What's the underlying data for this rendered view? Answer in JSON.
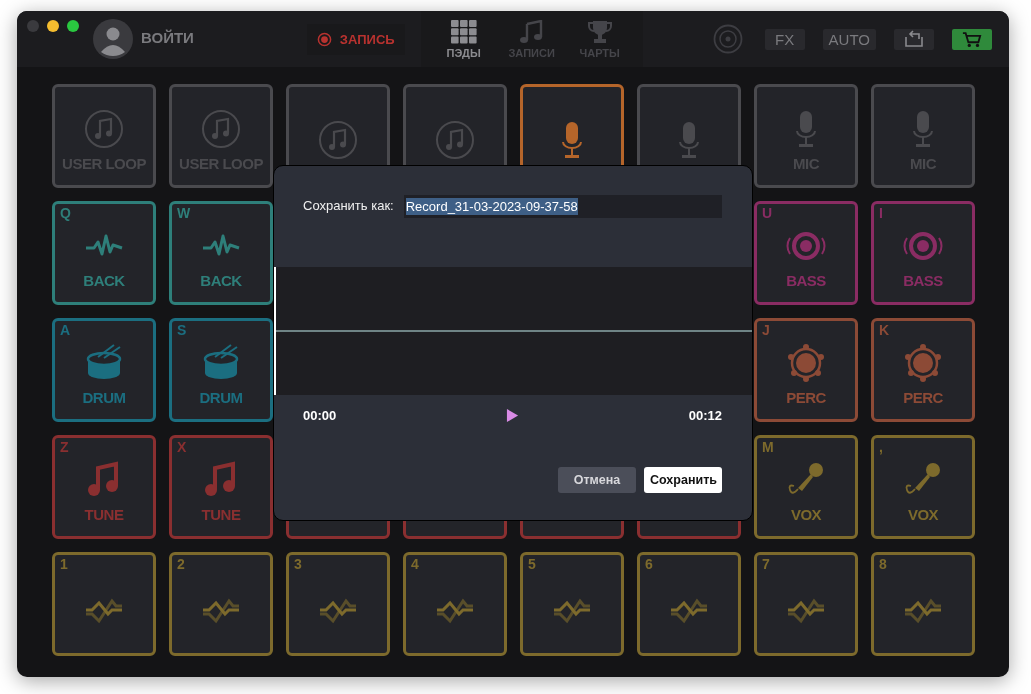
{
  "topbar": {
    "login": "ВОЙТИ",
    "record": "ЗАПИСЬ",
    "tabs": [
      {
        "label": "ПЭДЫ",
        "kind": "grid",
        "selected": true
      },
      {
        "label": "ЗАПИСИ",
        "kind": "notes",
        "selected": false
      },
      {
        "label": "ЧАРТЫ",
        "kind": "trophy",
        "selected": false
      }
    ],
    "buttons": [
      {
        "kind": "text",
        "label": "FX"
      },
      {
        "kind": "text",
        "label": "AUTO"
      },
      {
        "kind": "undo"
      },
      {
        "kind": "cart"
      }
    ]
  },
  "pads": [
    [
      {
        "kind": "loop",
        "label": "USER LOOP",
        "color": "#4a4a4e"
      },
      {
        "kind": "loop",
        "label": "USER LOOP",
        "color": "#4a4a4e"
      },
      {
        "kind": "loop",
        "color": "#4a4a4e"
      },
      {
        "kind": "loop",
        "color": "#4a4a4e"
      },
      {
        "kind": "mic",
        "color": "#b5652a"
      },
      {
        "kind": "mic",
        "color": "#4a4a4e"
      },
      {
        "kind": "mic",
        "label": "MIC",
        "color": "#4a4a4e"
      },
      {
        "kind": "mic",
        "label": "MIC",
        "color": "#4a4a4e"
      }
    ],
    [
      {
        "key": "Q",
        "kind": "back",
        "label": "BACK",
        "color": "#2e7f7a"
      },
      {
        "key": "W",
        "kind": "back",
        "label": "BACK",
        "color": "#2e7f7a"
      },
      {
        "key": "U",
        "kind": "bass",
        "label": "BASS",
        "color": "#8a2c63"
      },
      {
        "key": "I",
        "kind": "bass",
        "label": "BASS",
        "color": "#8a2c63"
      }
    ],
    [
      {
        "key": "A",
        "kind": "drum",
        "label": "DRUM",
        "color": "#1b6e80"
      },
      {
        "key": "S",
        "kind": "drum",
        "label": "DRUM",
        "color": "#1b6e80"
      },
      {
        "key": "J",
        "kind": "perc",
        "label": "PERC",
        "color": "#8c4a36"
      },
      {
        "key": "K",
        "kind": "perc",
        "label": "PERC",
        "color": "#8c4a36"
      }
    ],
    [
      {
        "key": "Z",
        "kind": "tune",
        "label": "TUNE",
        "color": "#8a2f30"
      },
      {
        "key": "X",
        "kind": "tune",
        "label": "TUNE",
        "color": "#8a2f30"
      },
      {
        "color": "#8a2f30"
      },
      {
        "color": "#8a2f30"
      },
      {
        "color": "#8a2f30"
      },
      {
        "color": "#8a2f30"
      },
      {
        "key": "M",
        "kind": "vox",
        "label": "VOX",
        "color": "#7d6a2c"
      },
      {
        "key": ",",
        "kind": "vox",
        "label": "VOX",
        "color": "#7d6a2c"
      }
    ],
    [
      {
        "key": "1",
        "kind": "fx",
        "color": "#7d6a2c"
      },
      {
        "key": "2",
        "kind": "fx",
        "color": "#7d6a2c"
      },
      {
        "key": "3",
        "kind": "fx",
        "color": "#7d6a2c"
      },
      {
        "key": "4",
        "kind": "fx",
        "color": "#7d6a2c"
      },
      {
        "key": "5",
        "kind": "fx",
        "color": "#7d6a2c"
      },
      {
        "key": "6",
        "kind": "fx",
        "color": "#7d6a2c"
      },
      {
        "key": "7",
        "kind": "fx",
        "color": "#7d6a2c"
      },
      {
        "key": "8",
        "kind": "fx",
        "color": "#7d6a2c"
      }
    ]
  ],
  "dialog": {
    "label": "Сохранить как:",
    "value": "Record_31-03-2023-09-37-58",
    "start_time": "00:00",
    "end_time": "00:12",
    "cancel": "Отмена",
    "save": "Сохранить"
  }
}
